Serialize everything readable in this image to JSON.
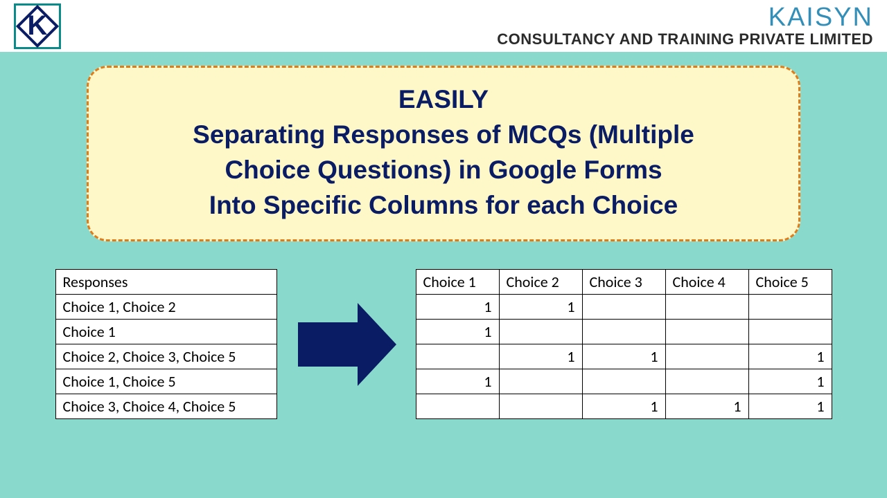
{
  "brand": {
    "name": "KAISYN",
    "sub": "CONSULTANCY AND TRAINING PRIVATE LIMITED",
    "logo_letter": "K"
  },
  "title": {
    "line1": "EASILY",
    "line2": "Separating Responses of MCQs (Multiple",
    "line3": "Choice Questions) in Google Forms",
    "line4": "Into Specific Columns for each Choice"
  },
  "responses_table": {
    "header": "Responses",
    "rows": [
      "Choice 1, Choice 2",
      "Choice 1",
      "Choice 2, Choice 3, Choice 5",
      "Choice 1, Choice 5",
      "Choice 3, Choice 4, Choice 5"
    ]
  },
  "choices_table": {
    "headers": [
      "Choice 1",
      "Choice 2",
      "Choice 3",
      "Choice 4",
      "Choice 5"
    ],
    "rows": [
      [
        "1",
        "1",
        "",
        "",
        ""
      ],
      [
        "1",
        "",
        "",
        "",
        ""
      ],
      [
        "",
        "1",
        "1",
        "",
        "1"
      ],
      [
        "1",
        "",
        "",
        "",
        "1"
      ],
      [
        "",
        "",
        "1",
        "1",
        "1"
      ]
    ]
  }
}
